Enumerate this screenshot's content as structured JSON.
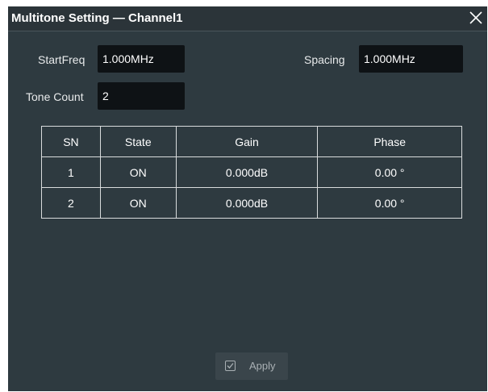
{
  "dialog": {
    "title": "Multitone Setting — Channel1",
    "close_icon": "close-icon"
  },
  "fields": {
    "start_freq": {
      "label": "StartFreq",
      "value": "1.000MHz"
    },
    "spacing": {
      "label": "Spacing",
      "value": "1.000MHz"
    },
    "tone_count": {
      "label": "Tone Count",
      "value": "2"
    }
  },
  "table": {
    "headers": [
      "SN",
      "State",
      "Gain",
      "Phase"
    ],
    "rows": [
      [
        "1",
        "ON",
        "0.000dB",
        "0.00 °"
      ],
      [
        "2",
        "ON",
        "0.000dB",
        "0.00 °"
      ]
    ]
  },
  "apply": {
    "label": "Apply",
    "icon": "checkbox-icon"
  },
  "colors": {
    "dialog_background": "#2e3a40",
    "input_background": "#0e1215",
    "text": "#ffffff",
    "border": "#d9dcdd"
  }
}
